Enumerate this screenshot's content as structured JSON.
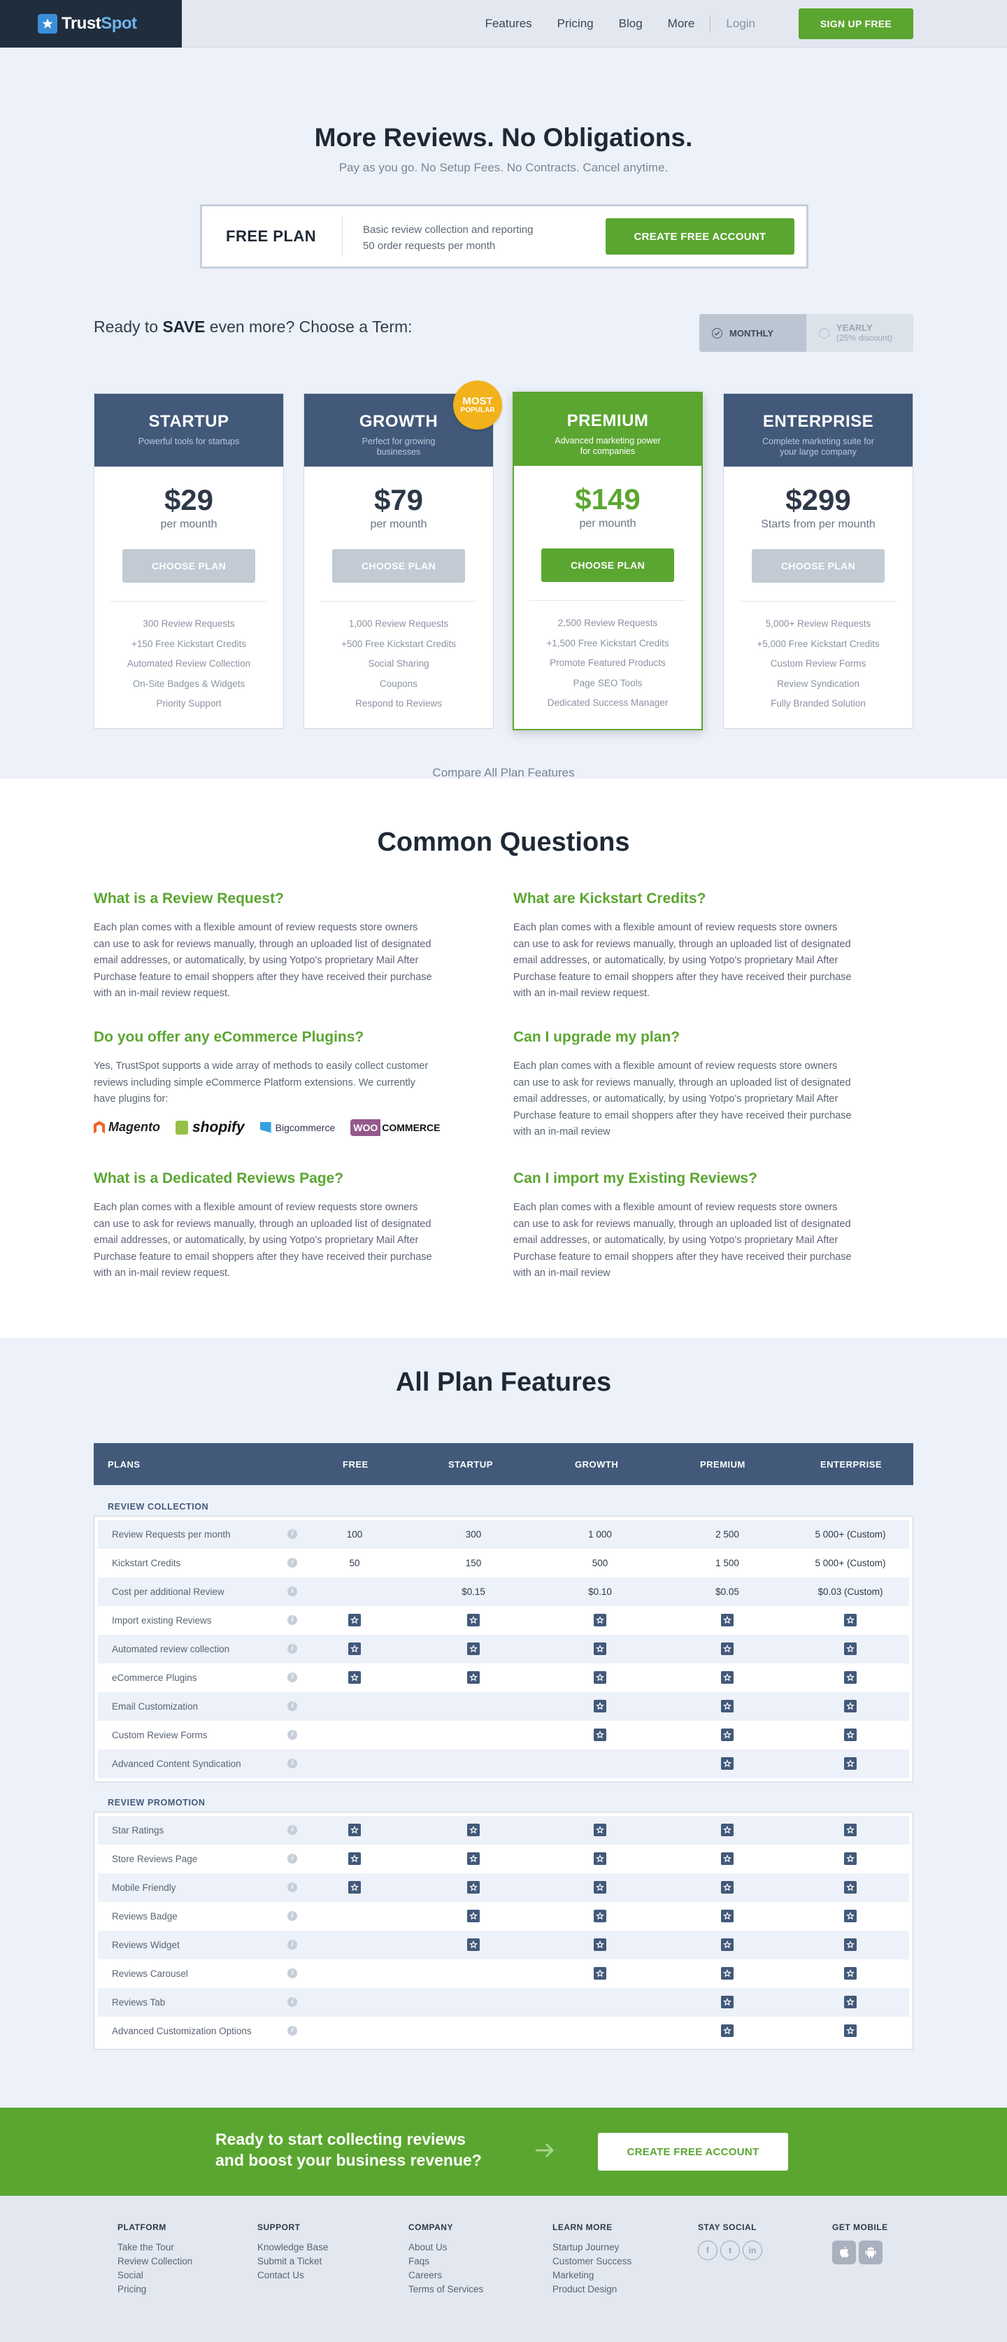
{
  "header": {
    "brand_a": "Trust",
    "brand_b": "Spot",
    "nav": [
      "Features",
      "Pricing",
      "Blog",
      "More"
    ],
    "login": "Login",
    "signup": "SIGN UP FREE"
  },
  "hero": {
    "title": "More Reviews. No Obligations.",
    "subtitle": "Pay as you go. No Setup Fees. No Contracts. Cancel anytime."
  },
  "free_plan": {
    "title": "FREE PLAN",
    "desc1": "Basic review collection and reporting",
    "desc2": "50 order requests per month",
    "button": "CREATE FREE ACCOUNT"
  },
  "term": {
    "prefix": "Ready to ",
    "save": "SAVE",
    "suffix": " even more? Choose a Term:",
    "monthly": "MONTHLY",
    "yearly": "YEARLY",
    "yearly_sub": "(25% discount)"
  },
  "plans": [
    {
      "name": "STARTUP",
      "desc": "Powerful tools for startups",
      "price": "$29",
      "per": "per mounth",
      "button": "CHOOSE PLAN",
      "features": [
        "300 Review Requests",
        "+150 Free Kickstart Credits",
        "Automated Review Collection",
        "On-Site Badges & Widgets",
        "Priority Support"
      ]
    },
    {
      "name": "GROWTH",
      "desc": "Perfect for growing businesses",
      "price": "$79",
      "per": "per mounth",
      "button": "CHOOSE PLAN",
      "features": [
        "1,000 Review Requests",
        "+500 Free Kickstart Credits",
        "Social Sharing",
        "Coupons",
        "Respond to Reviews"
      ]
    },
    {
      "name": "PREMIUM",
      "desc": "Advanced marketing power for companies",
      "price": "$149",
      "per": "per mounth",
      "button": "CHOOSE PLAN",
      "features": [
        "2,500 Review Requests",
        "+1,500 Free Kickstart Credits",
        "Promote Featured Products",
        "Page SEO Tools",
        "Dedicated Success Manager"
      ]
    },
    {
      "name": "ENTERPRISE",
      "desc": "Complete marketing suite for your  large company",
      "price": "$299",
      "per": "Starts from per mounth",
      "button": "CHOOSE PLAN",
      "features": [
        "5,000+ Review Requests",
        "+5,000 Free Kickstart Credits",
        "Custom Review Forms",
        "Review Syndication",
        "Fully Branded Solution"
      ]
    }
  ],
  "badge": {
    "line1": "MOST",
    "line2": "POPULAR"
  },
  "compare": "Compare All Plan Features",
  "faq": {
    "title": "Common Questions",
    "items": [
      {
        "q": "What is a Review Request?",
        "a": "Each plan comes with a flexible amount of review requests store owners can use to ask for reviews manually, through an uploaded list of designated email addresses, or automatically, by using Yotpo's proprietary Mail After Purchase feature to email shoppers after they have received their purchase with an in-mail review request."
      },
      {
        "q": "What are Kickstart Credits?",
        "a": "Each plan comes with a flexible amount of review requests store owners can use to ask for reviews manually, through an uploaded list of designated email addresses, or automatically, by using Yotpo's proprietary Mail After Purchase feature to email shoppers after they have received their purchase with an in-mail review request."
      },
      {
        "q": "Do you offer any eCommerce Plugins?",
        "a": "Yes, TrustSpot supports a wide array of methods to easily collect customer reviews including simple eCommerce Platform extensions. We currently have plugins for:"
      },
      {
        "q": "Can I upgrade my plan?",
        "a": "Each plan comes with a flexible amount of review requests store owners can use to ask for reviews manually, through an uploaded list of designated email addresses, or automatically, by using Yotpo's proprietary Mail After Purchase feature to email shoppers after they have received their purchase with an in-mail review"
      },
      {
        "q": "What is a Dedicated Reviews Page?",
        "a": "Each plan comes with a flexible amount of review requests store owners can use to ask for reviews manually, through an uploaded list of designated email addresses, or automatically, by using Yotpo's proprietary Mail After Purchase feature to email shoppers after they have received their purchase with an in-mail review request."
      },
      {
        "q": "Can I import my Existing Reviews?",
        "a": "Each plan comes with a flexible amount of review requests store owners can use to ask for reviews manually, through an uploaded list of designated email addresses, or automatically, by using Yotpo's proprietary Mail After Purchase feature to email shoppers after they have received their purchase with an in-mail review"
      }
    ],
    "plugins": {
      "magento": "Magento",
      "shopify": "shopify",
      "bigcommerce": "Bigcommerce",
      "woo": "WOO",
      "commerce": "COMMERCE"
    }
  },
  "features": {
    "title": "All Plan Features",
    "columns": [
      "PLANS",
      "FREE",
      "STARTUP",
      "GROWTH",
      "PREMIUM",
      "ENTERPRISE"
    ],
    "info_glyph": "i",
    "sections": [
      {
        "name": "REVIEW COLLECTION",
        "rows": [
          {
            "label": "Review Requests per month",
            "cells": [
              "100",
              "300",
              "1 000",
              "2 500",
              "5 000+ (Custom)"
            ]
          },
          {
            "label": "Kickstart Credits",
            "cells": [
              "50",
              "150",
              "500",
              "1 500",
              "5 000+ (Custom)"
            ]
          },
          {
            "label": "Cost per additional Review",
            "cells": [
              "",
              "$0.15",
              "$0.10",
              "$0.05",
              "$0.03 (Custom)"
            ]
          },
          {
            "label": "Import existing Reviews",
            "cells": [
              true,
              true,
              true,
              true,
              true
            ]
          },
          {
            "label": "Automated review collection",
            "cells": [
              true,
              true,
              true,
              true,
              true
            ]
          },
          {
            "label": "eCommerce Plugins",
            "cells": [
              true,
              true,
              true,
              true,
              true
            ]
          },
          {
            "label": "Email Customization",
            "cells": [
              false,
              false,
              true,
              true,
              true
            ]
          },
          {
            "label": "Custom Review Forms",
            "cells": [
              false,
              false,
              true,
              true,
              true
            ]
          },
          {
            "label": "Advanced Content Syndication",
            "cells": [
              false,
              false,
              false,
              true,
              true
            ]
          }
        ]
      },
      {
        "name": "REVIEW PROMOTION",
        "rows": [
          {
            "label": "Star Ratings",
            "cells": [
              true,
              true,
              true,
              true,
              true
            ]
          },
          {
            "label": "Store Reviews Page",
            "cells": [
              true,
              true,
              true,
              true,
              true
            ]
          },
          {
            "label": "Mobile Friendly",
            "cells": [
              true,
              true,
              true,
              true,
              true
            ]
          },
          {
            "label": "Reviews Badge",
            "cells": [
              false,
              true,
              true,
              true,
              true
            ]
          },
          {
            "label": "Reviews Widget",
            "cells": [
              false,
              true,
              true,
              true,
              true
            ]
          },
          {
            "label": "Reviews Carousel",
            "cells": [
              false,
              false,
              true,
              true,
              true
            ]
          },
          {
            "label": "Reviews Tab",
            "cells": [
              false,
              false,
              false,
              true,
              true
            ]
          },
          {
            "label": "Advanced Customization Options",
            "cells": [
              false,
              false,
              false,
              true,
              true
            ]
          }
        ]
      }
    ]
  },
  "cta": {
    "line1": "Ready to start collecting reviews",
    "line2": "and boost your business revenue?",
    "button": "CREATE FREE ACCOUNT"
  },
  "footer": {
    "columns": [
      {
        "title": "PLATFORM",
        "links": [
          "Take the Tour",
          "Review Collection",
          "Social",
          "Pricing"
        ]
      },
      {
        "title": "SUPPORT",
        "links": [
          "Knowledge Base",
          "Submit a Ticket",
          "Contact Us"
        ]
      },
      {
        "title": "COMPANY",
        "links": [
          "About Us",
          "Faqs",
          "Careers",
          "Terms of Services"
        ]
      },
      {
        "title": "LEARN MORE",
        "links": [
          "Startup Journey",
          "Customer Success",
          "Marketing",
          "Product Design"
        ]
      }
    ],
    "social_title": "STAY SOCIAL",
    "social": [
      "f",
      "t",
      "in"
    ],
    "mobile_title": "GET MOBILE",
    "icons": [
      "facebook-icon",
      "twitter-icon",
      "linkedin-icon",
      "apple-icon",
      "android-icon"
    ]
  },
  "colors": {
    "green": "#5ba631",
    "navy": "#42597a",
    "dark": "#1f2d3d",
    "bg": "#edf1f9",
    "badge": "#f2b21b"
  }
}
